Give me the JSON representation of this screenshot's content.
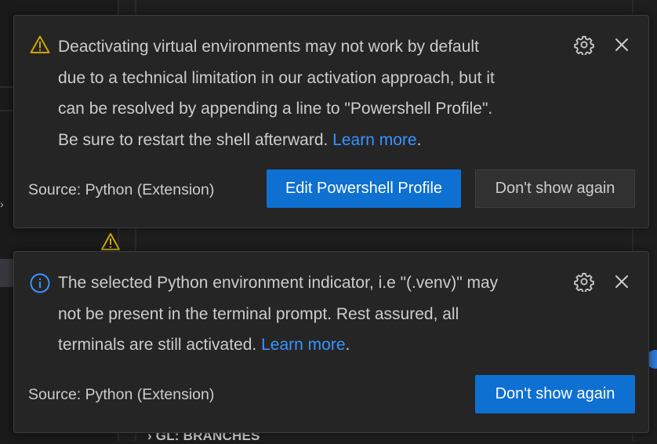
{
  "background": {
    "branches_label": "GL: BRANCHES"
  },
  "notifications": [
    {
      "severity": "warning",
      "icon": "warning-icon",
      "message_text": "Deactivating virtual environments may not work by default\ndue to a technical limitation in our activation approach, but it\ncan be resolved by appending a line to \"Powershell Profile\".\nBe sure to restart the shell afterward. ",
      "link_text": "Learn more",
      "trailing": ".",
      "source": "Source: Python (Extension)",
      "buttons": {
        "primary": "Edit Powershell Profile",
        "secondary": "Don't show again"
      }
    },
    {
      "severity": "info",
      "icon": "info-icon",
      "message_text": "The selected Python environment indicator, i.e \"(.venv)\" may\nnot be present in the terminal prompt. Rest assured, all\nterminals are still activated. ",
      "link_text": "Learn more",
      "trailing": ".",
      "source": "Source: Python (Extension)",
      "buttons": {
        "primary": "Don't show again"
      }
    }
  ],
  "colors": {
    "warning": "#cca700",
    "info": "#3794ff",
    "primary_button": "#0e70d1",
    "link": "#3794ff",
    "toast_bg": "#252526"
  }
}
